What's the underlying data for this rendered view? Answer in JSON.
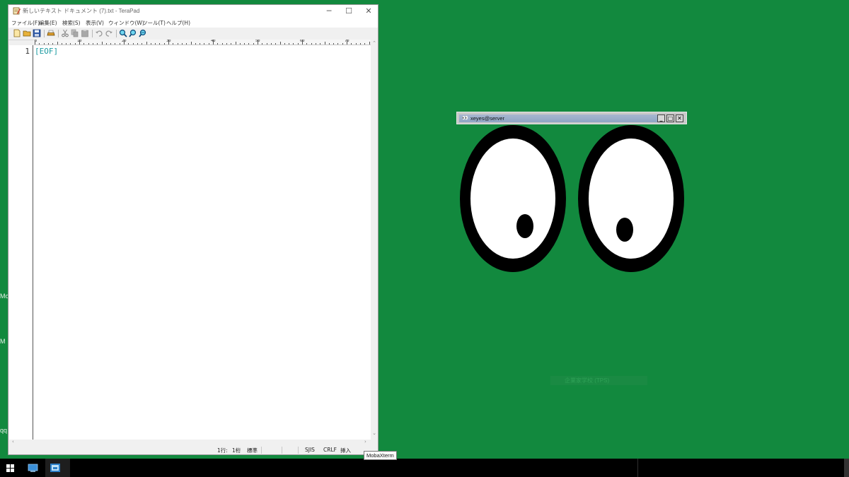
{
  "desktop": {
    "labels": [
      "Mo",
      "M",
      "qq"
    ],
    "ghost_text": "企業家学校 (TPS)"
  },
  "terapad": {
    "title": "新しいテキスト ドキュメント (7).txt - TeraPad",
    "menu": [
      "ファイル(F)",
      "編集(E)",
      "検索(S)",
      "表示(V)",
      "ウィンドウ(W)",
      "ツール(T)",
      "ヘルプ(H)"
    ],
    "ruler_labels": [
      "0",
      "10",
      "20",
      "30",
      "40",
      "50",
      "60",
      "70"
    ],
    "line_number": "1",
    "eof_marker": "[EOF]",
    "status": {
      "line": "1行:",
      "col": "1桁",
      "mode": "標準",
      "encoding": "SJIS",
      "newline": "CRLF",
      "insert": "挿入"
    },
    "icons": [
      "new-icon",
      "open-icon",
      "save-icon",
      "print-icon",
      "cut-icon",
      "copy-icon",
      "paste-icon",
      "undo-icon",
      "redo-icon",
      "find-icon",
      "find-next-icon",
      "find-prev-icon"
    ]
  },
  "xeyes": {
    "title": "xeyes@server",
    "colors": {
      "outline": "#000000",
      "sclera": "#ffffff",
      "pupil": "#000000"
    }
  },
  "taskbar": {
    "tooltip": "MobaXterm"
  },
  "colors": {
    "desktop": "#12893e",
    "taskbar": "#000000",
    "eof": "#1a9aa0"
  }
}
